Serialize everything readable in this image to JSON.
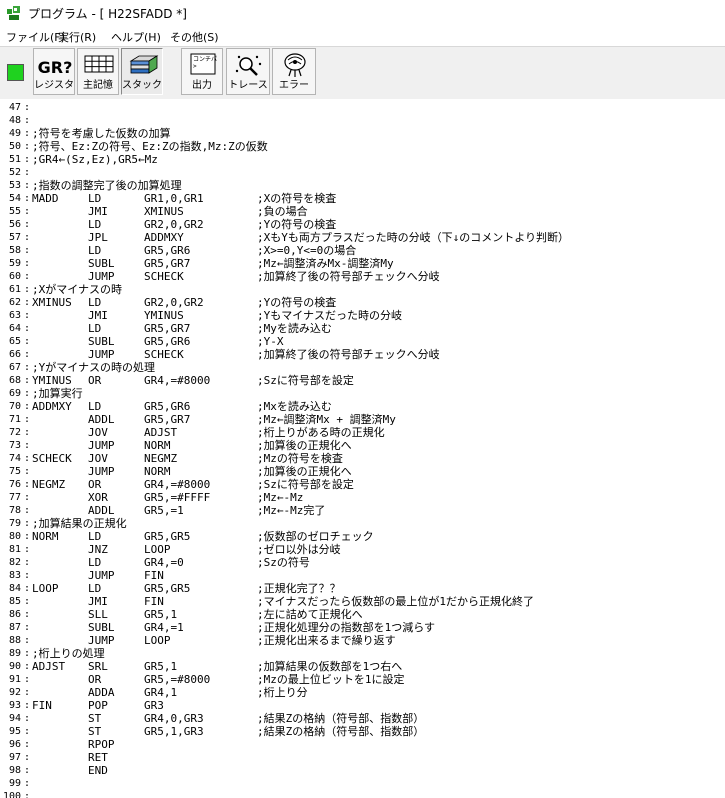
{
  "window": {
    "title": "プログラム - [ H22SFADD *]"
  },
  "menu": [
    {
      "label": "ファイル(F)"
    },
    {
      "label": "実行(R)"
    },
    {
      "label": "ヘルプ(H)"
    },
    {
      "label": "その他(S)"
    }
  ],
  "toolbar": {
    "run_indicator_color": "#1fd21f",
    "buttons": [
      {
        "id": "register",
        "label": "レジスタ",
        "icon": "register-icon",
        "icon_text": "GR?"
      },
      {
        "id": "memory",
        "label": "主記憶",
        "icon": "memory-grid-icon"
      },
      {
        "id": "stack",
        "label": "スタック",
        "icon": "stack-icon"
      },
      {
        "id": "output",
        "label": "出力",
        "icon": "console-icon",
        "icon_text": "コンチパ"
      },
      {
        "id": "trace",
        "label": "トレース",
        "icon": "trace-magnifier-icon"
      },
      {
        "id": "error",
        "label": "エラー",
        "icon": "error-icon"
      }
    ]
  },
  "editor": {
    "line_col_marker": ":",
    "lines": [
      {
        "n": "47",
        "text": ""
      },
      {
        "n": "48",
        "text": ""
      },
      {
        "n": "49",
        "text": ";符号を考慮した仮数の加算"
      },
      {
        "n": "50",
        "text": ";符号、Ez:Zの符号、Ez:Zの指数,Mz:Zの仮数"
      },
      {
        "n": "51",
        "text": ";GR4←(Sz,Ez),GR5←Mz"
      },
      {
        "n": "52",
        "text": ""
      },
      {
        "n": "53",
        "text": ";指数の調整完了後の加算処理"
      },
      {
        "n": "54",
        "label": "MADD",
        "op": "LD",
        "arg": "GR1,0,GR1",
        "cmt": ";Xの符号を検査"
      },
      {
        "n": "55",
        "label": "",
        "op": "JMI",
        "arg": "XMINUS",
        "cmt": ";負の場合"
      },
      {
        "n": "56",
        "label": "",
        "op": "LD",
        "arg": "GR2,0,GR2",
        "cmt": ";Yの符号の検査"
      },
      {
        "n": "57",
        "label": "",
        "op": "JPL",
        "arg": "ADDMXY",
        "cmt": ";XもYも両方プラスだった時の分岐（下↓のコメントより判断）"
      },
      {
        "n": "58",
        "label": "",
        "op": "LD",
        "arg": "GR5,GR6",
        "cmt": ";X>=0,Y<=0の場合"
      },
      {
        "n": "59",
        "label": "",
        "op": "SUBL",
        "arg": "GR5,GR7",
        "cmt": ";Mz←調整済みMx-調整済My"
      },
      {
        "n": "60",
        "label": "",
        "op": "JUMP",
        "arg": "SCHECK",
        "cmt": ";加算終了後の符号部チェックへ分岐"
      },
      {
        "n": "61",
        "text": ";Xがマイナスの時"
      },
      {
        "n": "62",
        "label": "XMINUS",
        "op": "LD",
        "arg": "GR2,0,GR2",
        "cmt": ";Yの符号の検査"
      },
      {
        "n": "63",
        "label": "",
        "op": "JMI",
        "arg": "YMINUS",
        "cmt": ";Yもマイナスだった時の分岐"
      },
      {
        "n": "64",
        "label": "",
        "op": "LD",
        "arg": "GR5,GR7",
        "cmt": ";Myを読み込む"
      },
      {
        "n": "65",
        "label": "",
        "op": "SUBL",
        "arg": "GR5,GR6",
        "cmt": ";Y-X"
      },
      {
        "n": "66",
        "label": "",
        "op": "JUMP",
        "arg": "SCHECK",
        "cmt": ";加算終了後の符号部チェックへ分岐"
      },
      {
        "n": "67",
        "text": ";Yがマイナスの時の処理"
      },
      {
        "n": "68",
        "label": "YMINUS",
        "op": "OR",
        "arg": "GR4,=#8000",
        "cmt": ";Szに符号部を設定"
      },
      {
        "n": "69",
        "text": ";加算実行"
      },
      {
        "n": "70",
        "label": "ADDMXY",
        "op": "LD",
        "arg": "GR5,GR6",
        "cmt": ";Mxを読み込む"
      },
      {
        "n": "71",
        "label": "",
        "op": "ADDL",
        "arg": "GR5,GR7",
        "cmt": ";Mz←調整済Mx + 調整済My"
      },
      {
        "n": "72",
        "label": "",
        "op": "JOV",
        "arg": "ADJST",
        "cmt": ";桁上りがある時の正規化"
      },
      {
        "n": "73",
        "label": "",
        "op": "JUMP",
        "arg": "NORM",
        "cmt": ";加算後の正規化へ"
      },
      {
        "n": "74",
        "label": "SCHECK",
        "op": "JOV",
        "arg": "NEGMZ",
        "cmt": ";Mzの符号を検査"
      },
      {
        "n": "75",
        "label": "",
        "op": "JUMP",
        "arg": "NORM",
        "cmt": ";加算後の正規化へ"
      },
      {
        "n": "76",
        "label": "NEGMZ",
        "op": "OR",
        "arg": "GR4,=#8000",
        "cmt": ";Szに符号部を設定"
      },
      {
        "n": "77",
        "label": "",
        "op": "XOR",
        "arg": "GR5,=#FFFF",
        "cmt": ";Mz←-Mz"
      },
      {
        "n": "78",
        "label": "",
        "op": "ADDL",
        "arg": "GR5,=1",
        "cmt": ";Mz←-Mz完了"
      },
      {
        "n": "79",
        "text": ";加算結果の正規化"
      },
      {
        "n": "80",
        "label": "NORM",
        "op": "LD",
        "arg": "GR5,GR5",
        "cmt": ";仮数部のゼロチェック"
      },
      {
        "n": "81",
        "label": "",
        "op": "JNZ",
        "arg": "LOOP",
        "cmt": ";ゼロ以外は分岐"
      },
      {
        "n": "82",
        "label": "",
        "op": "LD",
        "arg": "GR4,=0",
        "cmt": ";Szの符号"
      },
      {
        "n": "83",
        "label": "",
        "op": "JUMP",
        "arg": "FIN",
        "cmt": ""
      },
      {
        "n": "84",
        "label": "LOOP",
        "op": "LD",
        "arg": "GR5,GR5",
        "cmt": ";正規化完了？？"
      },
      {
        "n": "85",
        "label": "",
        "op": "JMI",
        "arg": "FIN",
        "cmt": ";マイナスだったら仮数部の最上位が1だから正規化終了"
      },
      {
        "n": "86",
        "label": "",
        "op": "SLL",
        "arg": "GR5,1",
        "cmt": ";左に詰めて正規化へ"
      },
      {
        "n": "87",
        "label": "",
        "op": "SUBL",
        "arg": "GR4,=1",
        "cmt": ";正規化処理分の指数部を1つ減らす"
      },
      {
        "n": "88",
        "label": "",
        "op": "JUMP",
        "arg": "LOOP",
        "cmt": ";正規化出来るまで繰り返す"
      },
      {
        "n": "89",
        "text": ";桁上りの処理"
      },
      {
        "n": "90",
        "label": "ADJST",
        "op": "SRL",
        "arg": "GR5,1",
        "cmt": ";加算結果の仮数部を1つ右へ"
      },
      {
        "n": "91",
        "label": "",
        "op": "OR",
        "arg": "GR5,=#8000",
        "cmt": ";Mzの最上位ビットを1に設定"
      },
      {
        "n": "92",
        "label": "",
        "op": "ADDA",
        "arg": "GR4,1",
        "cmt": ";桁上り分"
      },
      {
        "n": "93",
        "label": "FIN",
        "op": "POP",
        "arg": "GR3",
        "cmt": ""
      },
      {
        "n": "94",
        "label": "",
        "op": "ST",
        "arg": "GR4,0,GR3",
        "cmt": ";結果Zの格納（符号部、指数部）"
      },
      {
        "n": "95",
        "label": "",
        "op": "ST",
        "arg": "GR5,1,GR3",
        "cmt": ";結果Zの格納（符号部、指数部）"
      },
      {
        "n": "96",
        "label": "",
        "op": "RPOP",
        "arg": "",
        "cmt": ""
      },
      {
        "n": "97",
        "label": "",
        "op": "RET",
        "arg": "",
        "cmt": ""
      },
      {
        "n": "98",
        "label": "",
        "op": "END",
        "arg": "",
        "cmt": ""
      },
      {
        "n": "99",
        "text": ""
      },
      {
        "n": "100",
        "text": ""
      }
    ]
  }
}
